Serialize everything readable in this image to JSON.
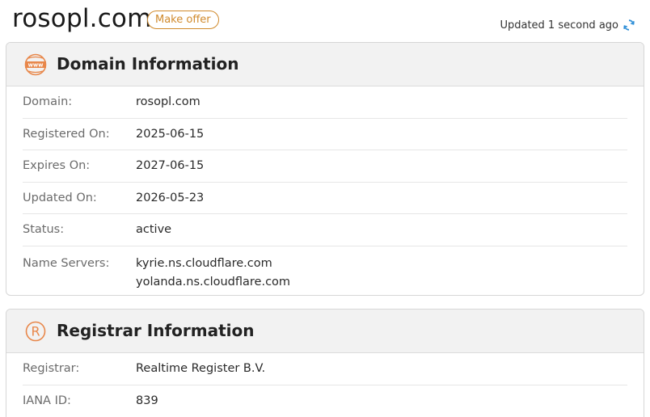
{
  "header": {
    "domain": "rosopl.com",
    "make_offer_label": "Make offer",
    "updated_text": "Updated 1 second ago"
  },
  "domain_info": {
    "title": "Domain Information",
    "rows": [
      {
        "label": "Domain:",
        "value": "rosopl.com"
      },
      {
        "label": "Registered On:",
        "value": "2025-06-15"
      },
      {
        "label": "Expires On:",
        "value": "2027-06-15"
      },
      {
        "label": "Updated On:",
        "value": "2026-05-23"
      },
      {
        "label": "Status:",
        "value": "active"
      }
    ],
    "name_servers": {
      "label": "Name Servers:",
      "values": [
        "kyrie.ns.cloudflare.com",
        "yolanda.ns.cloudflare.com"
      ]
    }
  },
  "registrar_info": {
    "title": "Registrar Information",
    "rows": [
      {
        "label": "Registrar:",
        "value": "Realtime Register B.V."
      },
      {
        "label": "IANA ID:",
        "value": "839"
      }
    ]
  },
  "icons": {
    "domain": "www-globe-icon",
    "registrar": "registered-trademark-icon",
    "refresh": "refresh-icon"
  },
  "colors": {
    "accent": "#e8874a",
    "offer": "#d08a2c",
    "refresh": "#2f8fd8",
    "card_header_bg": "#f2f2f2"
  }
}
